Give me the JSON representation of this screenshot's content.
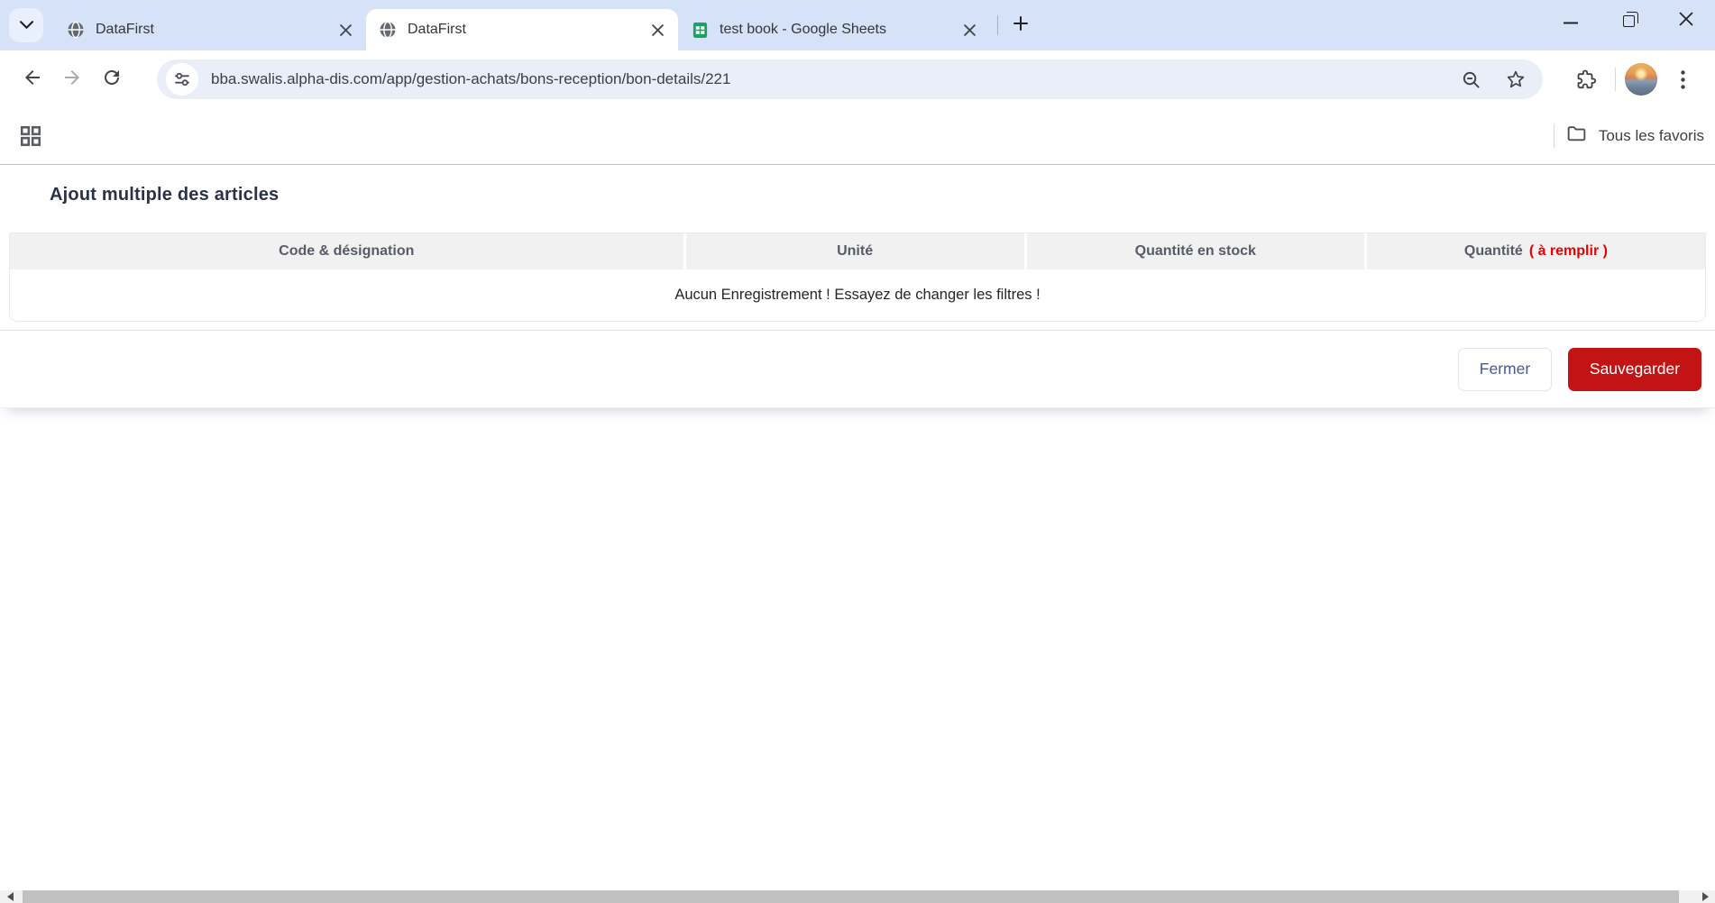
{
  "browser": {
    "tabs": [
      {
        "title": "DataFirst",
        "icon": "globe-icon",
        "active": false
      },
      {
        "title": "DataFirst",
        "icon": "globe-icon",
        "active": true
      },
      {
        "title": "test book - Google Sheets",
        "icon": "sheets-icon",
        "active": false
      }
    ],
    "address": {
      "url": "bba.swalis.alpha-dis.com/app/gestion-achats/bons-reception/bon-details/221"
    },
    "bookmarks": {
      "all_bookmarks_label": "Tous les favoris"
    }
  },
  "page": {
    "title": "Ajout multiple des articles",
    "table": {
      "headers": [
        "Code & désignation",
        "Unité",
        "Quantité en stock",
        "Quantité"
      ],
      "qty_required_suffix": "( à remplir )",
      "empty_message": "Aucun Enregistrement ! Essayez de changer les filtres !"
    },
    "footer": {
      "close_label": "Fermer",
      "save_label": "Sauvegarder"
    }
  },
  "colors": {
    "tabstrip_bg": "#d5e2f7",
    "omnibox_bg": "#e9eef8",
    "required_red": "#ee0000",
    "save_red": "#c21414",
    "close_btn_text": "#4a5795",
    "heading_color": "#2b3248"
  }
}
